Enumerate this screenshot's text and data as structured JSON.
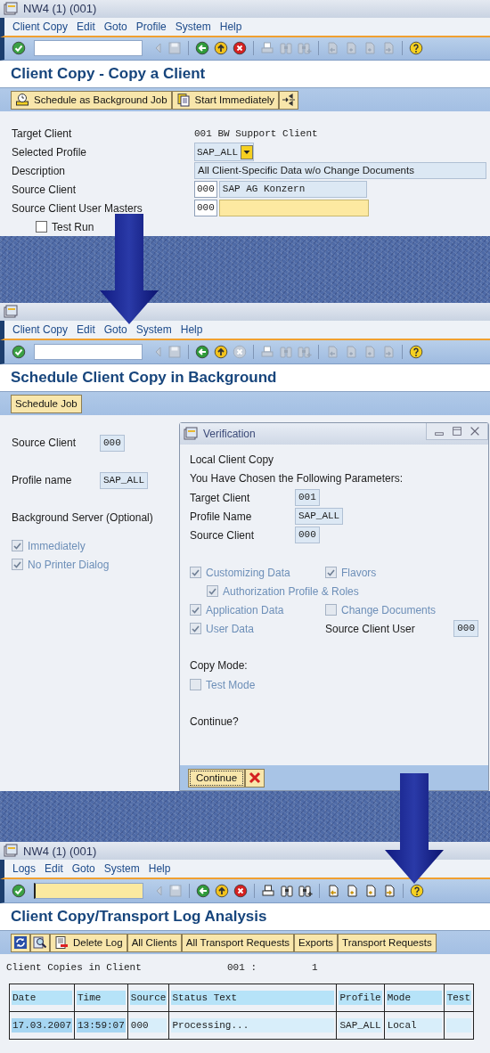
{
  "screens": [
    {
      "kind": "form",
      "title": "NW4 (1) (001)",
      "menu": [
        "Client Copy",
        "Edit",
        "Goto",
        "Profile",
        "System",
        "Help"
      ],
      "command_field": {
        "focused": false
      },
      "toolbar": [
        {
          "kind": "enter",
          "disabled": false
        },
        {
          "kind": "previous",
          "disabled": true
        },
        {
          "kind": "save",
          "disabled": true
        },
        {
          "kind": "back",
          "disabled": false
        },
        {
          "kind": "exit",
          "disabled": false
        },
        {
          "kind": "cancel",
          "disabled": false
        },
        {
          "kind": "print",
          "disabled": true
        },
        {
          "kind": "find",
          "disabled": true
        },
        {
          "kind": "find_next",
          "disabled": true
        },
        {
          "kind": "first_page",
          "disabled": true
        },
        {
          "kind": "prev_page",
          "disabled": true
        },
        {
          "kind": "next_page",
          "disabled": true
        },
        {
          "kind": "last_page",
          "disabled": true
        },
        {
          "kind": "help",
          "disabled": false
        }
      ],
      "heading": "Client Copy - Copy a Client",
      "app_buttons": [
        {
          "kind": "schedule",
          "label": "Schedule as Background Job"
        },
        {
          "kind": "start",
          "label": "Start Immediately"
        },
        {
          "kind": "expand"
        }
      ],
      "form": [
        {
          "label": "Target Client",
          "fields": [
            {
              "kind": "text",
              "value": "001 BW Support Client"
            }
          ]
        },
        {
          "label": "Selected Profile",
          "fields": [
            {
              "kind": "dropdown",
              "value": "SAP_ALL"
            }
          ]
        },
        {
          "label": "Description",
          "fields": [
            {
              "kind": "display",
              "value": "All Client-Specific Data w/o Change Documents"
            }
          ]
        },
        {
          "label": "Source Client",
          "fields": [
            {
              "kind": "input",
              "value": "000"
            },
            {
              "kind": "display",
              "value": "SAP AG Konzern"
            }
          ]
        },
        {
          "label": "Source Client User Masters",
          "fields": [
            {
              "kind": "input",
              "value": "000"
            },
            {
              "kind": "entry"
            }
          ]
        }
      ],
      "checkboxes": [
        {
          "label": "Test Run",
          "checked": false,
          "disabled": false
        }
      ]
    },
    {
      "kind": "schedule",
      "menu": [
        "Client Copy",
        "Edit",
        "Goto",
        "System",
        "Help"
      ],
      "command_field": {
        "focused": false
      },
      "toolbar": [
        {
          "kind": "enter",
          "disabled": false
        },
        {
          "kind": "previous",
          "disabled": true
        },
        {
          "kind": "save",
          "disabled": true
        },
        {
          "kind": "back",
          "disabled": false
        },
        {
          "kind": "exit",
          "disabled": false
        },
        {
          "kind": "cancel",
          "disabled": true
        },
        {
          "kind": "print",
          "disabled": true
        },
        {
          "kind": "find",
          "disabled": true
        },
        {
          "kind": "find_next",
          "disabled": true
        },
        {
          "kind": "first_page",
          "disabled": true
        },
        {
          "kind": "prev_page",
          "disabled": true
        },
        {
          "kind": "next_page",
          "disabled": true
        },
        {
          "kind": "last_page",
          "disabled": true
        },
        {
          "kind": "help",
          "disabled": false
        }
      ],
      "heading": "Schedule Client Copy in Background",
      "app_buttons": [
        {
          "kind": "text",
          "label": "Schedule Job"
        }
      ],
      "fields": [
        {
          "label": "Source Client",
          "value": "000"
        },
        {
          "label": "Profile name",
          "value": "SAP_ALL"
        },
        {
          "label": "Background Server (Optional)"
        }
      ],
      "checkboxes": [
        {
          "label": "Immediately",
          "checked": true,
          "disabled": true
        },
        {
          "label": "No Printer Dialog",
          "checked": true,
          "disabled": true
        }
      ],
      "dialog": {
        "title": "Verification",
        "window_buttons": [
          {
            "kind": "minimize"
          },
          {
            "kind": "maximize"
          },
          {
            "kind": "close"
          }
        ],
        "lines": [
          "Local Client Copy",
          "You Have Chosen the Following Parameters:"
        ],
        "params": [
          {
            "label": "Target Client",
            "value": "001"
          },
          {
            "label": "Profile Name",
            "value": "SAP_ALL"
          },
          {
            "label": "Source Client",
            "value": "000"
          }
        ],
        "option_rows": [
          {
            "cells": [
              {
                "kind": "checkbox",
                "label": "Customizing Data",
                "checked": true,
                "disabled": true,
                "children": [
                  {
                    "label": "Authorization Profile & Roles",
                    "checked": true,
                    "disabled": true
                  }
                ]
              },
              {
                "kind": "checkbox",
                "label": "Flavors",
                "checked": true,
                "disabled": true
              }
            ]
          },
          {
            "cells": [
              {
                "kind": "checkbox",
                "label": "Application Data",
                "checked": true,
                "disabled": true
              },
              {
                "kind": "checkbox",
                "label": "Change Documents",
                "checked": false,
                "disabled": true
              }
            ]
          },
          {
            "cells": [
              {
                "kind": "checkbox",
                "label": "User Data",
                "checked": true,
                "disabled": true
              },
              {
                "kind": "field",
                "label": "Source Client User",
                "value": "000"
              }
            ]
          }
        ],
        "copy_mode_label": "Copy Mode:",
        "copy_mode": [
          {
            "label": "Test Mode",
            "checked": false,
            "disabled": true
          }
        ],
        "question": "Continue?",
        "buttons": [
          {
            "kind": "continue",
            "label": "Continue"
          },
          {
            "kind": "cancel"
          }
        ]
      }
    },
    {
      "kind": "log",
      "title": "NW4 (1) (001)",
      "menu": [
        "Logs",
        "Edit",
        "Goto",
        "System",
        "Help"
      ],
      "command_field": {
        "focused": true
      },
      "toolbar": [
        {
          "kind": "enter",
          "disabled": false
        },
        {
          "kind": "previous",
          "disabled": true
        },
        {
          "kind": "save",
          "disabled": true
        },
        {
          "kind": "back",
          "disabled": false
        },
        {
          "kind": "exit",
          "disabled": false
        },
        {
          "kind": "cancel",
          "disabled": false
        },
        {
          "kind": "print",
          "disabled": false
        },
        {
          "kind": "find",
          "disabled": false
        },
        {
          "kind": "find_next",
          "disabled": false
        },
        {
          "kind": "first_page",
          "disabled": false
        },
        {
          "kind": "prev_page",
          "disabled": false
        },
        {
          "kind": "next_page",
          "disabled": false
        },
        {
          "kind": "last_page",
          "disabled": false
        },
        {
          "kind": "help",
          "disabled": false
        }
      ],
      "heading": "Client Copy/Transport Log Analysis",
      "app_buttons": [
        {
          "kind": "refresh"
        },
        {
          "kind": "magnify"
        },
        {
          "kind": "delete",
          "label": "Delete Log"
        },
        {
          "kind": "text",
          "label": "All Clients"
        },
        {
          "kind": "text",
          "label": "All Transport Requests"
        },
        {
          "kind": "text",
          "label": "Exports"
        },
        {
          "kind": "text",
          "label": "Transport Requests"
        }
      ],
      "summary": {
        "label": "Client Copies in Client",
        "client": "001 :",
        "count": "1"
      },
      "table": {
        "columns": [
          "Date",
          "Time",
          "Source",
          "Status Text",
          "Profile",
          "Mode",
          "Test"
        ],
        "rows": [
          {
            "cells": [
              {
                "text": "17.03.2007",
                "highlighted": true
              },
              {
                "text": "13:59:07",
                "highlighted": true
              },
              {
                "text": "000",
                "highlighted": false
              },
              {
                "text": "Processing...",
                "highlighted": false
              },
              {
                "text": "SAP_ALL",
                "highlighted": false
              },
              {
                "text": "Local",
                "highlighted": false
              },
              {
                "highlighted": false
              }
            ]
          }
        ]
      }
    }
  ]
}
